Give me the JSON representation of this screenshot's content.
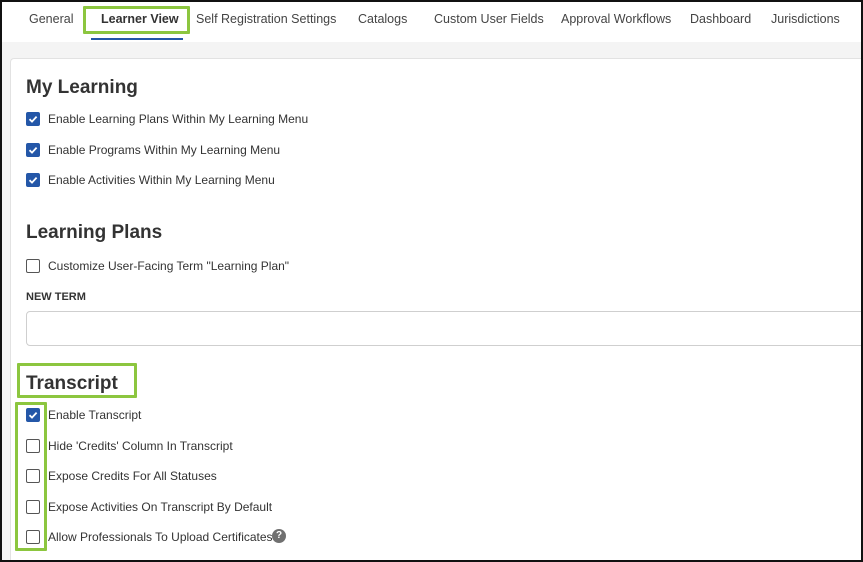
{
  "tabs": [
    {
      "label": "General"
    },
    {
      "label": "Learner View",
      "active": true
    },
    {
      "label": "Self Registration Settings"
    },
    {
      "label": "Catalogs"
    },
    {
      "label": "Custom User Fields"
    },
    {
      "label": "Approval Workflows"
    },
    {
      "label": "Dashboard"
    },
    {
      "label": "Jurisdictions"
    }
  ],
  "my_learning": {
    "title": "My Learning",
    "options": [
      {
        "label": "Enable Learning Plans Within My Learning Menu",
        "checked": true
      },
      {
        "label": "Enable Programs Within My Learning Menu",
        "checked": true
      },
      {
        "label": "Enable Activities Within My Learning Menu",
        "checked": true
      }
    ]
  },
  "learning_plans": {
    "title": "Learning Plans",
    "options": [
      {
        "label": "Customize User-Facing Term \"Learning Plan\"",
        "checked": false
      }
    ],
    "new_term_label": "NEW TERM",
    "new_term_value": ""
  },
  "transcript": {
    "title": "Transcript",
    "options": [
      {
        "label": "Enable Transcript",
        "checked": true
      },
      {
        "label": "Hide 'Credits' Column In Transcript",
        "checked": false
      },
      {
        "label": "Expose Credits For All Statuses",
        "checked": false
      },
      {
        "label": "Expose Activities On Transcript By Default",
        "checked": false
      },
      {
        "label": "Allow Professionals To Upload Certificates",
        "checked": false
      }
    ],
    "help_icon": "question-circle-icon"
  },
  "colors": {
    "accent": "#2457a8",
    "highlight": "#8cc63f"
  }
}
